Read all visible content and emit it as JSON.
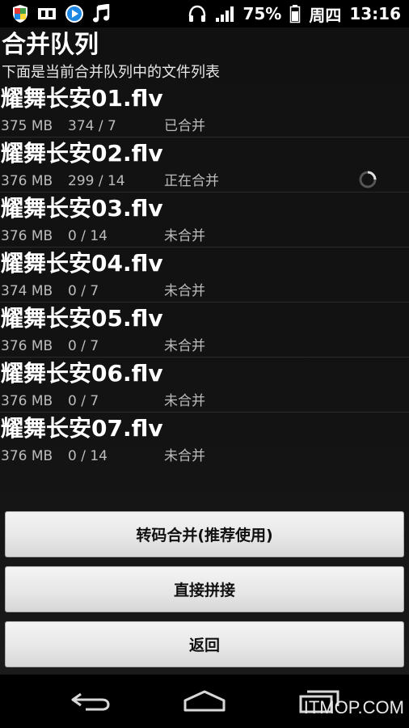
{
  "status_bar": {
    "icons_left": [
      "shield-icon",
      "flipboard-icon",
      "play-icon",
      "music-note-icon"
    ],
    "icons_right": [
      "headphones-icon",
      "signal-icon",
      "battery-icon"
    ],
    "battery": "75%",
    "day": "周四",
    "time": "13:16"
  },
  "header": {
    "title": "合并队列",
    "subtitle": "下面是当前合并队列中的文件列表"
  },
  "files": [
    {
      "name": "耀舞长安01.flv",
      "size": "375 MB",
      "parts": "374 / 7",
      "status": "已合并",
      "in_progress": false
    },
    {
      "name": "耀舞长安02.flv",
      "size": "376 MB",
      "parts": "299 / 14",
      "status": "正在合并",
      "in_progress": true
    },
    {
      "name": "耀舞长安03.flv",
      "size": "376 MB",
      "parts": "0 / 14",
      "status": "未合并",
      "in_progress": false
    },
    {
      "name": "耀舞长安04.flv",
      "size": "374 MB",
      "parts": "0 / 7",
      "status": "未合并",
      "in_progress": false
    },
    {
      "name": "耀舞长安05.flv",
      "size": "376 MB",
      "parts": "0 / 7",
      "status": "未合并",
      "in_progress": false
    },
    {
      "name": "耀舞长安06.flv",
      "size": "376 MB",
      "parts": "0 / 7",
      "status": "未合并",
      "in_progress": false
    },
    {
      "name": "耀舞长安07.flv",
      "size": "376 MB",
      "parts": "0 / 14",
      "status": "未合并",
      "in_progress": false
    }
  ],
  "buttons": {
    "transcode_merge": "转码合并(推荐使用)",
    "direct_concat": "直接拼接",
    "back": "返回"
  },
  "nav": {
    "icons": [
      "back-icon",
      "home-icon",
      "recent-apps-icon"
    ]
  },
  "watermark": "ITMOP.COM"
}
